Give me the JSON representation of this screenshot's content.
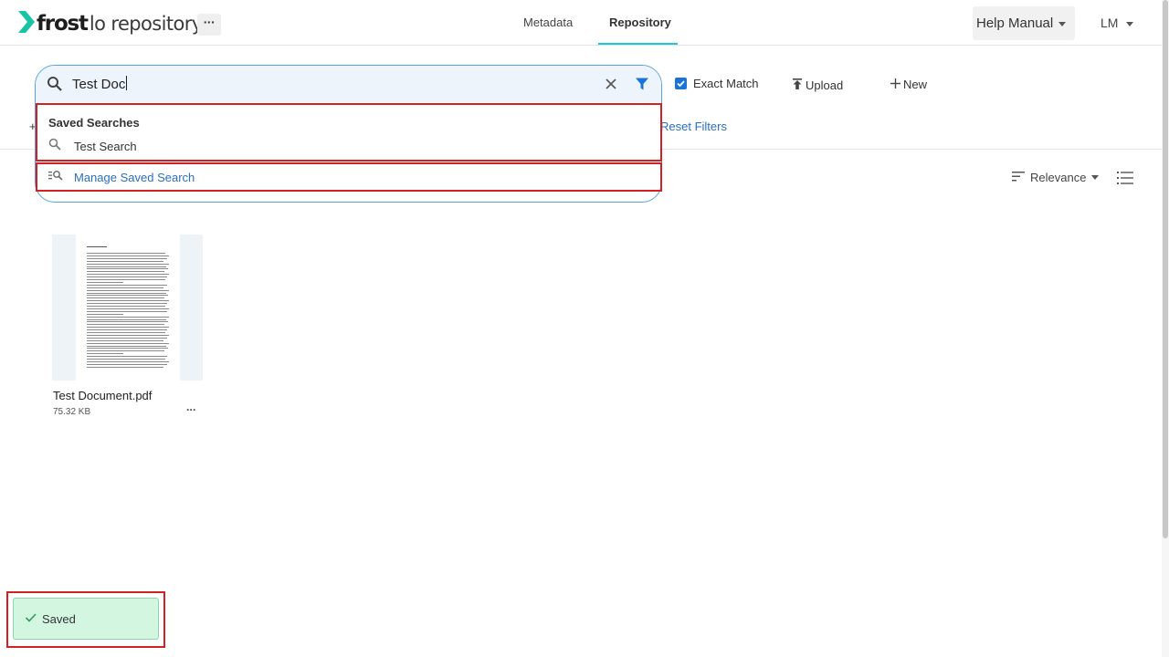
{
  "header": {
    "brand": "frost",
    "product": "lo repository",
    "more_label": "···",
    "tabs": [
      {
        "label": "Metadata",
        "active": false
      },
      {
        "label": "Repository",
        "active": true
      }
    ],
    "help_label": "Help Manual",
    "user_initials": "LM",
    "accent_color": "#1ec7e0"
  },
  "search": {
    "value": "Test Doc",
    "saved_heading": "Saved Searches",
    "saved_items": [
      "Test Search"
    ],
    "manage_label": "Manage Saved Search"
  },
  "toolbar": {
    "exact_match_label": "Exact Match",
    "exact_match_checked": true,
    "upload_label": "Upload",
    "new_label": "New",
    "reset_filters_label": "Reset Filters",
    "sort_label": "Relevance"
  },
  "documents": [
    {
      "name": "Test Document.pdf",
      "size": "75.32 KB",
      "menu": "···"
    }
  ],
  "toast": {
    "label": "Saved"
  },
  "icons": {
    "logo": "chevron-logo-icon",
    "search": "search-icon",
    "clear": "close-icon",
    "filter": "filter-icon",
    "saved_search": "search-icon",
    "manage": "manage-search-icon",
    "upload": "upload-icon",
    "new": "plus-icon",
    "sort": "sort-icon",
    "list_view": "list-view-icon",
    "toast": "check-icon"
  },
  "colors": {
    "link": "#2a6fc0",
    "highlight_box": "#d32020",
    "toast_bg": "#d3f6e1",
    "checkbox": "#1a73d9"
  }
}
